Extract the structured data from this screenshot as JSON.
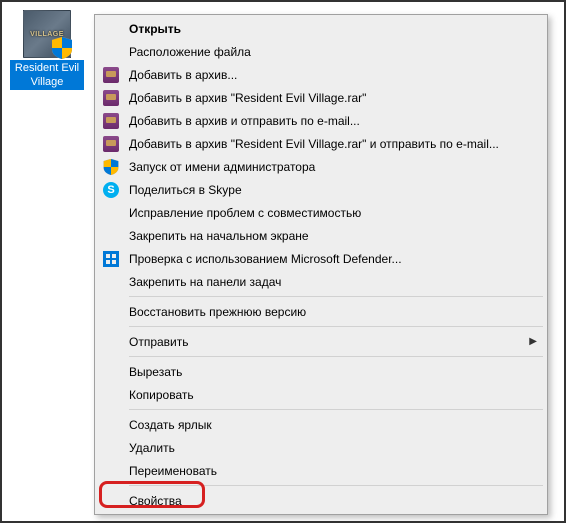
{
  "desktop_icon": {
    "label": "Resident Evil Village",
    "badge_text": "VILLAGE"
  },
  "menu": {
    "open": "Открыть",
    "file_location": "Расположение файла",
    "add_to_archive": "Добавить в архив...",
    "add_to_named": "Добавить в архив \"Resident Evil Village.rar\"",
    "add_and_email": "Добавить в архив и отправить по e-mail...",
    "add_named_email": "Добавить в архив \"Resident Evil Village.rar\" и отправить по e-mail...",
    "run_as_admin": "Запуск от имени администратора",
    "share_skype": "Поделиться в Skype",
    "troubleshoot": "Исправление проблем с совместимостью",
    "pin_start": "Закрепить на начальном экране",
    "defender_scan": "Проверка с использованием Microsoft Defender...",
    "pin_taskbar": "Закрепить на панели задач",
    "restore_previous": "Восстановить прежнюю версию",
    "send_to": "Отправить",
    "cut": "Вырезать",
    "copy": "Копировать",
    "create_shortcut": "Создать ярлык",
    "delete": "Удалить",
    "rename": "Переименовать",
    "properties": "Свойства"
  }
}
